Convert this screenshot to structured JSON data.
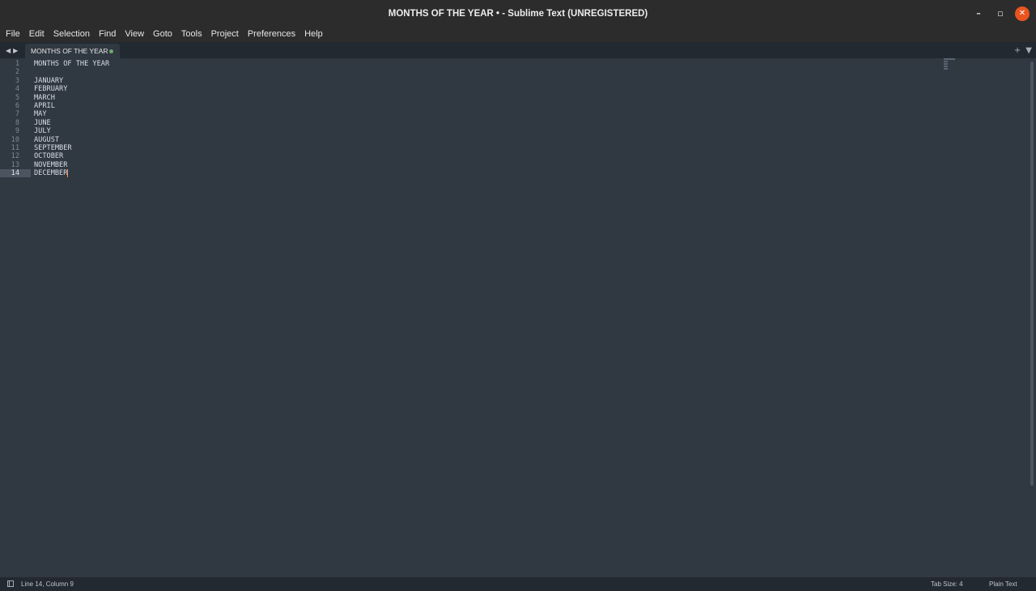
{
  "window": {
    "title": "MONTHS OF THE YEAR • - Sublime Text (UNREGISTERED)",
    "minimize_icon": "minimize-icon",
    "maximize_icon": "restore-icon",
    "close_icon": "close-icon"
  },
  "menu": {
    "items": [
      "File",
      "Edit",
      "Selection",
      "Find",
      "View",
      "Goto",
      "Tools",
      "Project",
      "Preferences",
      "Help"
    ]
  },
  "tabs": {
    "active_label": "MONTHS OF THE YEAR",
    "dirty_color": "#6ea86e"
  },
  "editor": {
    "lines": [
      "MONTHS OF THE YEAR",
      "",
      "JANUARY",
      "FEBRUARY",
      "MARCH",
      "APRIL",
      "MAY",
      "JUNE",
      "JULY",
      "AUGUST",
      "SEPTEMBER",
      "OCTOBER",
      "NOVEMBER",
      "DECEMBER"
    ],
    "line_numbers": [
      "1",
      "2",
      "3",
      "4",
      "5",
      "6",
      "7",
      "8",
      "9",
      "10",
      "11",
      "12",
      "13",
      "14"
    ],
    "active_line": 14,
    "caret_color": "#f99157"
  },
  "status": {
    "position": "Line 14, Column 9",
    "tab_size": "Tab Size: 4",
    "syntax": "Plain Text"
  }
}
